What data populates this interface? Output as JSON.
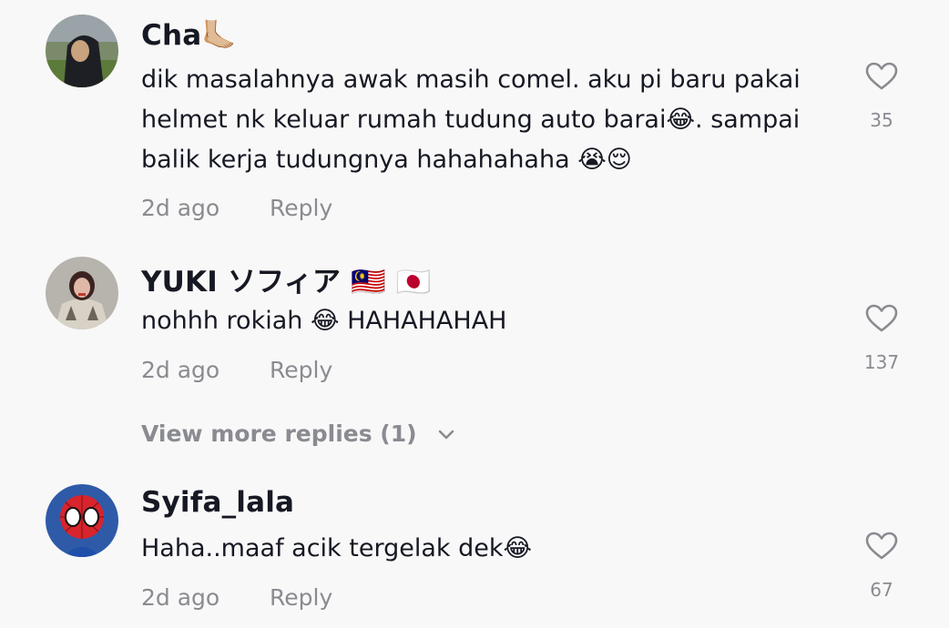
{
  "comments": [
    {
      "username": "Cha🦶🏼",
      "text": "dik masalahnya awak masih comel. aku pi baru pakai helmet nk keluar rumah tudung auto barai😂. sampai balik kerja tudungnya hahahahaha 😭😌",
      "time": "2d ago",
      "reply_label": "Reply",
      "likes": "35"
    },
    {
      "username": "YUKI ソフィア 🇲🇾 🇯🇵",
      "text": "nohhh rokiah 😂 HAHAHAHAH",
      "time": "2d ago",
      "reply_label": "Reply",
      "likes": "137",
      "view_more": "View more replies (1)"
    },
    {
      "username": "Syifa_lala",
      "text": "Haha..maaf acik tergelak dek😂",
      "time": "2d ago",
      "reply_label": "Reply",
      "likes": "67"
    }
  ]
}
